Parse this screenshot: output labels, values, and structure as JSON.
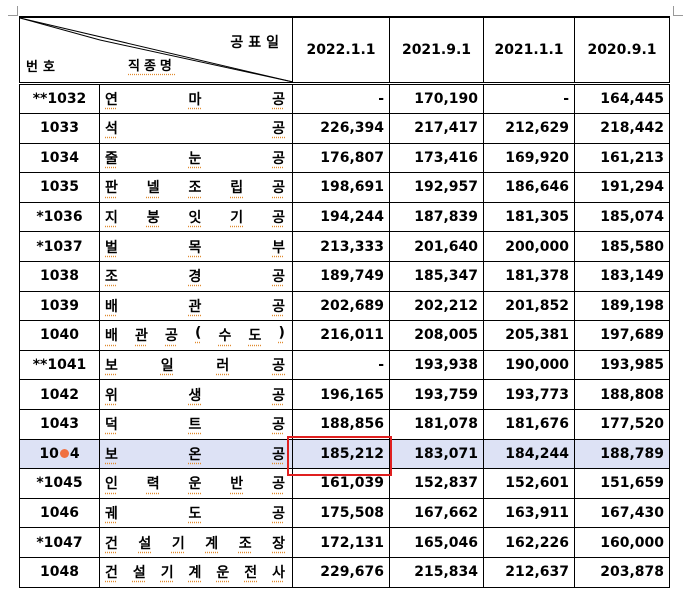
{
  "header": {
    "announce_label": "공표일",
    "number_label": "번호",
    "job_label": "직종명",
    "dates": [
      "2022.1.1",
      "2021.9.1",
      "2021.1.1",
      "2020.9.1"
    ]
  },
  "rows": [
    {
      "code": "**1032",
      "name": [
        "연",
        "마",
        "공"
      ],
      "values": [
        "-",
        "170,190",
        "-",
        "164,445"
      ]
    },
    {
      "code": "1033",
      "name": [
        "석",
        "공"
      ],
      "values": [
        "226,394",
        "217,417",
        "212,629",
        "218,442"
      ]
    },
    {
      "code": "1034",
      "name": [
        "줄",
        "눈",
        "공"
      ],
      "values": [
        "176,807",
        "173,416",
        "169,920",
        "161,213"
      ]
    },
    {
      "code": "1035",
      "name": [
        "판",
        "넬",
        "조",
        "립",
        "공"
      ],
      "values": [
        "198,691",
        "192,957",
        "186,646",
        "191,294"
      ]
    },
    {
      "code": "*1036",
      "name": [
        "지",
        "붕",
        "잇",
        "기",
        "공"
      ],
      "values": [
        "194,244",
        "187,839",
        "181,305",
        "185,074"
      ]
    },
    {
      "code": "*1037",
      "name": [
        "벌",
        "목",
        "부"
      ],
      "values": [
        "213,333",
        "201,640",
        "200,000",
        "185,580"
      ]
    },
    {
      "code": "1038",
      "name": [
        "조",
        "경",
        "공"
      ],
      "values": [
        "189,749",
        "185,347",
        "181,378",
        "183,149"
      ]
    },
    {
      "code": "1039",
      "name": [
        "배",
        "관",
        "공"
      ],
      "values": [
        "202,689",
        "202,212",
        "201,852",
        "189,198"
      ]
    },
    {
      "code": "1040",
      "name": [
        "배",
        "관",
        "공",
        "(",
        "수",
        "도",
        ")"
      ],
      "values": [
        "216,011",
        "208,005",
        "205,381",
        "197,689"
      ]
    },
    {
      "code": "**1041",
      "name": [
        "보",
        "일",
        "러",
        "공"
      ],
      "values": [
        "-",
        "193,938",
        "190,000",
        "193,985"
      ]
    },
    {
      "code": "1042",
      "name": [
        "위",
        "생",
        "공"
      ],
      "values": [
        "196,165",
        "193,759",
        "193,773",
        "188,808"
      ]
    },
    {
      "code": "1043",
      "name": [
        "덕",
        "트",
        "공"
      ],
      "values": [
        "188,856",
        "181,078",
        "181,676",
        "177,520"
      ]
    },
    {
      "code_pre": "10",
      "code_post": "4",
      "name": [
        "보",
        "온",
        "공"
      ],
      "values": [
        "185,212",
        "183,071",
        "184,244",
        "188,789"
      ],
      "highlight": true
    },
    {
      "code": "*1045",
      "name": [
        "인",
        "력",
        "운",
        "반",
        "공"
      ],
      "values": [
        "161,039",
        "152,837",
        "152,601",
        "151,659"
      ]
    },
    {
      "code": "1046",
      "name": [
        "궤",
        "도",
        "공"
      ],
      "values": [
        "175,508",
        "167,662",
        "163,911",
        "167,430"
      ]
    },
    {
      "code": "*1047",
      "name": [
        "건",
        "설",
        "기",
        "계",
        "조",
        "장"
      ],
      "values": [
        "172,131",
        "165,046",
        "162,226",
        "160,000"
      ]
    },
    {
      "code": "1048",
      "name": [
        "건",
        "설",
        "기",
        "계",
        "운",
        "전",
        "사"
      ],
      "values": [
        "229,676",
        "215,834",
        "212,637",
        "203,878"
      ]
    }
  ]
}
